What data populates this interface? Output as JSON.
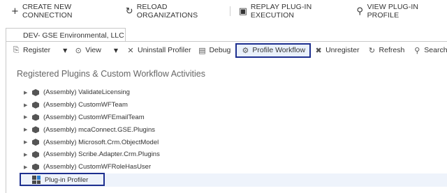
{
  "topbar": {
    "create_label": "CREATE NEW CONNECTION",
    "reload_label": "RELOAD ORGANIZATIONS",
    "replay_label": "REPLAY PLUG-IN EXECUTION",
    "view_profile_label": "VIEW PLUG-IN PROFILE"
  },
  "tab": {
    "title": "DEV- GSE Environmental, LLC"
  },
  "toolbar": {
    "register": "Register",
    "view": "View",
    "uninstall": "Uninstall Profiler",
    "debug": "Debug",
    "profile_workflow": "Profile Workflow",
    "unregister": "Unregister",
    "refresh": "Refresh",
    "search": "Search"
  },
  "main": {
    "title": "Registered Plugins & Custom Workflow Activities",
    "items": [
      "(Assembly) ValidateLicensing",
      "(Assembly) CustomWFTeam",
      "(Assembly) CustomWFEmailTeam",
      "(Assembly) mcaConnect.GSE.Plugins",
      "(Assembly) Microsoft.Crm.ObjectModel",
      "(Assembly) Scribe.Adapter.Crm.Plugins",
      "(Assembly) CustomWFRoleHasUser"
    ],
    "profiler": "Plug-in Profiler"
  },
  "colors": {
    "selected_border": "#1d2f8f",
    "selected_bg": "#eaf1fb"
  }
}
